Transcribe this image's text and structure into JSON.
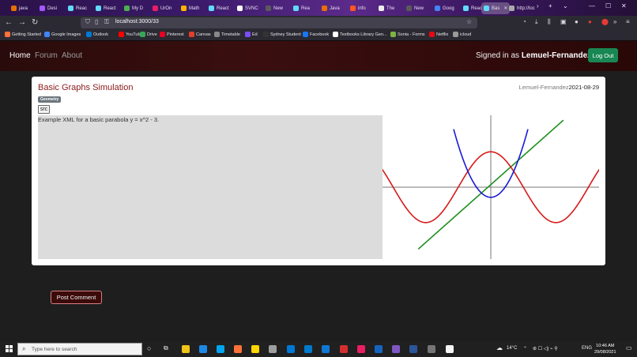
{
  "browser": {
    "tabs": [
      {
        "label": "java",
        "color": "#e76f00"
      },
      {
        "label": "Desi",
        "color": "#a259ff"
      },
      {
        "label": "Reac",
        "color": "#61dafb"
      },
      {
        "label": "React",
        "color": "#61dafb"
      },
      {
        "label": "My D",
        "color": "#4caf50"
      },
      {
        "label": "UrOn",
        "color": "#e91e63"
      },
      {
        "label": "Math",
        "color": "#ffb300"
      },
      {
        "label": "React",
        "color": "#61dafb"
      },
      {
        "label": "SVNC",
        "color": "#ffffff"
      },
      {
        "label": "New",
        "color": "#5a5a5a"
      },
      {
        "label": "Rea",
        "color": "#61dafb"
      },
      {
        "label": "Java",
        "color": "#e76f00"
      },
      {
        "label": "info",
        "color": "#ff5722"
      },
      {
        "label": "The",
        "color": "#eeeeee"
      },
      {
        "label": "New",
        "color": "#5a5a5a"
      },
      {
        "label": "Goog",
        "color": "#4285f4"
      },
      {
        "label": "Reac",
        "color": "#61dafb"
      },
      {
        "label": "Bas",
        "color": "#61dafb",
        "active": true
      },
      {
        "label": "http://loc",
        "color": "#aaaaaa"
      }
    ],
    "url": "localhost:3000/33",
    "bookmarks": [
      {
        "label": "Getting Started",
        "color": "#ff7139"
      },
      {
        "label": "Google Images",
        "color": "#4285f4"
      },
      {
        "label": "Outlook",
        "color": "#0078d4"
      },
      {
        "label": "YouTube",
        "color": "#ff0000"
      },
      {
        "label": "Drive",
        "color": "#34a853"
      },
      {
        "label": "Pinterest",
        "color": "#e60023"
      },
      {
        "label": "Canvas",
        "color": "#e13f2b"
      },
      {
        "label": "Timetable",
        "color": "#888888"
      },
      {
        "label": "Ed",
        "color": "#7c4dff"
      },
      {
        "label": "Sydney Student",
        "color": "#333333"
      },
      {
        "label": "Facebook",
        "color": "#1877f2"
      },
      {
        "label": "Textbooks Library Gen...",
        "color": "#ffffff"
      },
      {
        "label": "Sonia - Forms",
        "color": "#7cb342"
      },
      {
        "label": "Netflix",
        "color": "#e50914"
      },
      {
        "label": "icloud",
        "color": "#999999"
      }
    ]
  },
  "site": {
    "nav": {
      "home": "Home",
      "forum": "Forum",
      "about": "About"
    },
    "signed_in_prefix": "Signed in as",
    "username": "Lemuel-Fernandez",
    "logout_label": "Log Out"
  },
  "post": {
    "title": "Basic Graphs Simulation",
    "author": "Lemuel-Fernandez",
    "date": "2021-08-29",
    "tag": "Geometry",
    "src_label": "src",
    "xml_text": "Example XML for a basic parabola y = x^2 - 3."
  },
  "graph": {
    "curves": [
      {
        "name": "parabola",
        "color": "#1a1ad6"
      },
      {
        "name": "line",
        "color": "#1f8f1f"
      },
      {
        "name": "wave",
        "color": "#d61a1a"
      }
    ],
    "axis_color": "#777777"
  },
  "comment_button": "Post Comment",
  "taskbar": {
    "search_placeholder": "Type here to search",
    "weather": "14°C",
    "language": "ENG",
    "time": "10:46 AM",
    "date": "29/08/2021",
    "apps": [
      "#f0c419",
      "#1e88e5",
      "#00a4ef",
      "#ff7139",
      "#ffd600",
      "#9e9e9e",
      "#0078d4",
      "#007acc",
      "#0f78d4",
      "#d32f2f",
      "#e91e63",
      "#1565c0",
      "#7e57c2",
      "#2b579a",
      "#757575",
      "#f5f5f5"
    ]
  }
}
